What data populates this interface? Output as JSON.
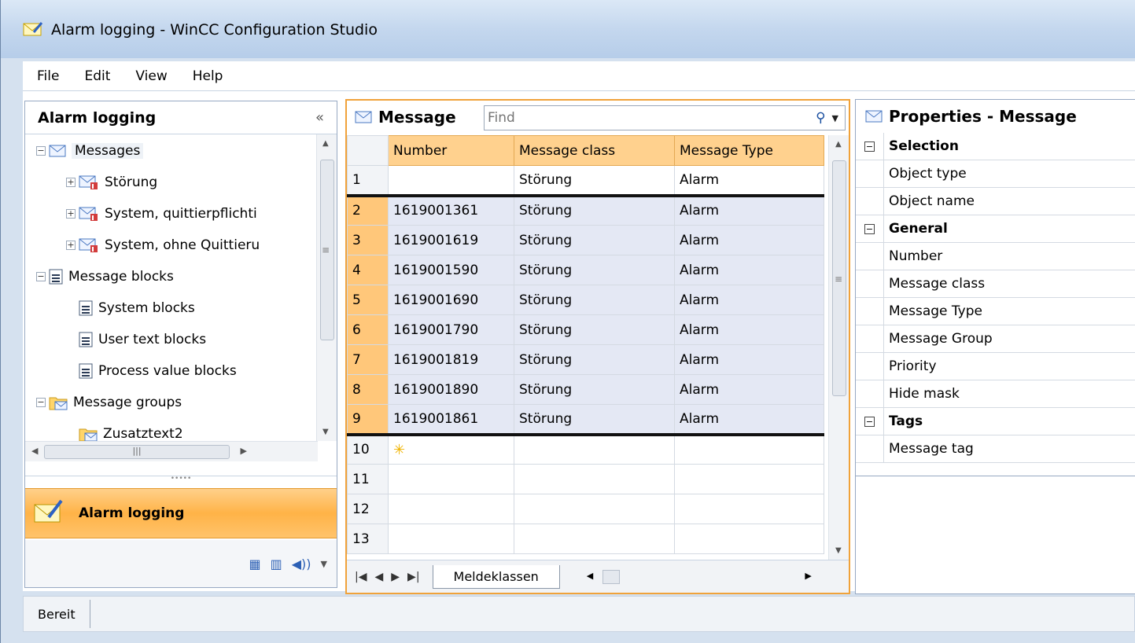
{
  "window": {
    "title": "Alarm logging - WinCC Configuration Studio"
  },
  "menu": [
    "File",
    "Edit",
    "View",
    "Help"
  ],
  "navigation": {
    "title": "Alarm logging",
    "tree": [
      {
        "label": "Messages",
        "level": 0,
        "icon": "envelope-icon",
        "expander": "⊟"
      },
      {
        "label": "Störung",
        "level": 1,
        "icon": "message-class-icon",
        "expander": "⊞"
      },
      {
        "label": "System, quittierpflichti",
        "level": 1,
        "icon": "message-class-icon",
        "expander": "⊞"
      },
      {
        "label": "System, ohne Quittieru",
        "level": 1,
        "icon": "message-class-icon",
        "expander": "⊞"
      },
      {
        "label": "Message blocks",
        "level": 0,
        "icon": "block-icon",
        "expander": "⊟"
      },
      {
        "label": "System blocks",
        "level": 1,
        "icon": "block-icon"
      },
      {
        "label": "User text blocks",
        "level": 1,
        "icon": "block-icon"
      },
      {
        "label": "Process value blocks",
        "level": 1,
        "icon": "block-icon"
      },
      {
        "label": "Message groups",
        "level": 0,
        "icon": "folder-icon",
        "expander": "⊟"
      },
      {
        "label": "Zusatztext2",
        "level": 1,
        "icon": "folder-icon"
      }
    ],
    "active_button": "Alarm logging"
  },
  "editor": {
    "title": "Message",
    "find_placeholder": "Find",
    "columns": [
      "Number",
      "Message class",
      "Message Type"
    ],
    "rows": [
      {
        "n": "1",
        "number": "",
        "class": "Störung",
        "type": "Alarm"
      },
      {
        "n": "2",
        "number": "1619001361",
        "class": "Störung",
        "type": "Alarm"
      },
      {
        "n": "3",
        "number": "1619001619",
        "class": "Störung",
        "type": "Alarm"
      },
      {
        "n": "4",
        "number": "1619001590",
        "class": "Störung",
        "type": "Alarm"
      },
      {
        "n": "5",
        "number": "1619001690",
        "class": "Störung",
        "type": "Alarm"
      },
      {
        "n": "6",
        "number": "1619001790",
        "class": "Störung",
        "type": "Alarm"
      },
      {
        "n": "7",
        "number": "1619001819",
        "class": "Störung",
        "type": "Alarm"
      },
      {
        "n": "8",
        "number": "1619001890",
        "class": "Störung",
        "type": "Alarm"
      },
      {
        "n": "9",
        "number": "1619001861",
        "class": "Störung",
        "type": "Alarm"
      },
      {
        "n": "10",
        "number": "",
        "class": "",
        "type": ""
      },
      {
        "n": "11",
        "number": "",
        "class": "",
        "type": ""
      },
      {
        "n": "12",
        "number": "",
        "class": "",
        "type": ""
      },
      {
        "n": "13",
        "number": "",
        "class": "",
        "type": ""
      }
    ],
    "sheet_tab": "Meldeklassen"
  },
  "properties": {
    "title": "Properties - Message",
    "items": [
      {
        "label": "Selection",
        "category": true
      },
      {
        "label": "Object type"
      },
      {
        "label": "Object name"
      },
      {
        "label": "General",
        "category": true
      },
      {
        "label": "Number"
      },
      {
        "label": "Message class"
      },
      {
        "label": "Message Type"
      },
      {
        "label": "Message Group"
      },
      {
        "label": "Priority"
      },
      {
        "label": "Hide mask"
      },
      {
        "label": "Tags",
        "category": true
      },
      {
        "label": "Message tag"
      }
    ]
  },
  "status": {
    "text": "Bereit"
  },
  "colors": {
    "accent": "#f0a23a",
    "selection": "#e4e8f4"
  }
}
